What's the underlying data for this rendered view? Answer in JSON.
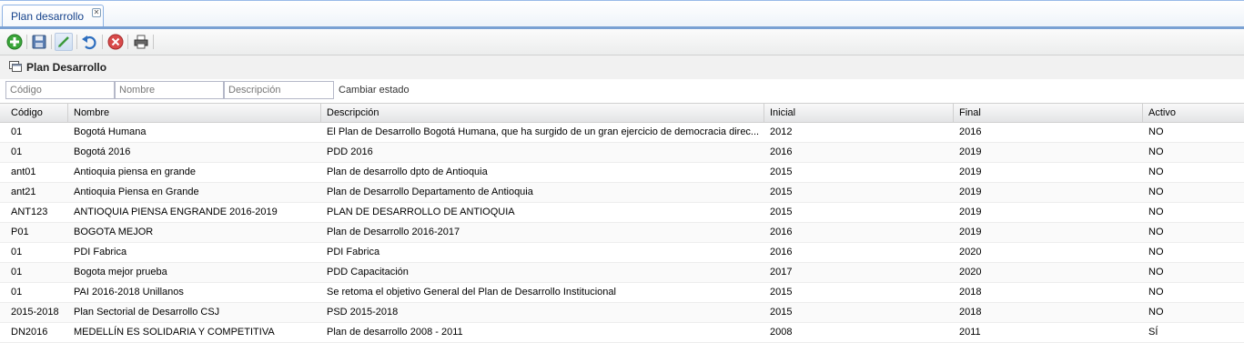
{
  "tabs": [
    {
      "label": "Plan desarrollo",
      "close_symbol": "✕"
    }
  ],
  "toolbar": {
    "buttons": [
      {
        "name": "add-icon",
        "color": "#2e9e2e"
      },
      {
        "name": "save-icon",
        "color": "#4a6fa5"
      },
      {
        "name": "edit-icon",
        "color": "#3b9a3b"
      },
      {
        "name": "undo-icon",
        "color": "#2f6fbf"
      },
      {
        "name": "cancel-icon",
        "color": "#d33b3b"
      },
      {
        "name": "print-icon",
        "color": "#555555"
      }
    ]
  },
  "panel": {
    "title": "Plan Desarrollo"
  },
  "filters": {
    "codigo_placeholder": "Código",
    "nombre_placeholder": "Nombre",
    "descripcion_placeholder": "Descripción",
    "cambiar_estado": "Cambiar estado"
  },
  "grid": {
    "columns": [
      "Código",
      "Nombre",
      "Descripción",
      "Inicial",
      "Final",
      "Activo"
    ],
    "rows": [
      [
        "01",
        "Bogotá Humana",
        "El Plan de Desarrollo Bogotá Humana, que ha surgido de un gran ejercicio de democracia direc...",
        "2012",
        "2016",
        "NO"
      ],
      [
        "01",
        "Bogotá 2016",
        "PDD 2016",
        "2016",
        "2019",
        "NO"
      ],
      [
        "ant01",
        "Antioquia piensa en grande",
        "Plan de desarrollo dpto de Antioquia",
        "2015",
        "2019",
        "NO"
      ],
      [
        "ant21",
        "Antioquia Piensa en Grande",
        "Plan de Desarrollo Departamento de Antioquia",
        "2015",
        "2019",
        "NO"
      ],
      [
        "ANT123",
        "ANTIOQUIA PIENSA ENGRANDE 2016-2019",
        "PLAN DE DESARROLLO DE ANTIOQUIA",
        "2015",
        "2019",
        "NO"
      ],
      [
        "P01",
        "BOGOTA MEJOR",
        "Plan de Desarrollo 2016-2017",
        "2016",
        "2019",
        "NO"
      ],
      [
        "01",
        "PDI Fabrica",
        "PDI Fabrica",
        "2016",
        "2020",
        "NO"
      ],
      [
        "01",
        "Bogota mejor prueba",
        "PDD Capacitación",
        "2017",
        "2020",
        "NO"
      ],
      [
        "01",
        "PAI 2016-2018 Unillanos",
        "Se retoma el objetivo General del Plan de Desarrollo Institucional",
        "2015",
        "2018",
        "NO"
      ],
      [
        "2015-2018",
        "Plan Sectorial de Desarrollo CSJ",
        "PSD 2015-2018",
        "2015",
        "2018",
        "NO"
      ],
      [
        "DN2016",
        "MEDELLÍN ES SOLIDARIA Y COMPETITIVA",
        "Plan de desarrollo 2008 - 2011",
        "2008",
        "2011",
        "SÍ"
      ]
    ]
  }
}
